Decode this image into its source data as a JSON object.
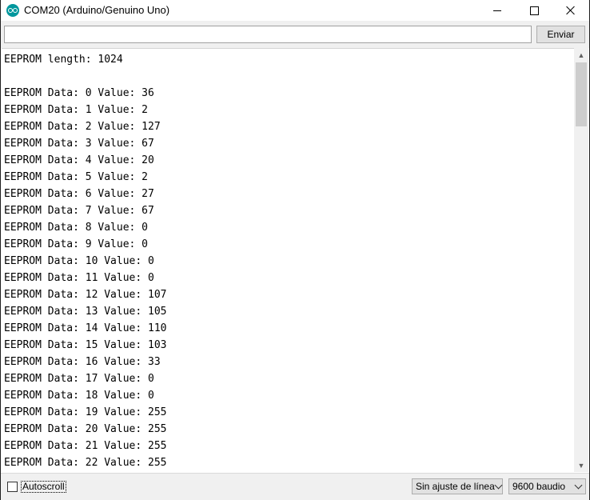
{
  "window": {
    "title": "COM20 (Arduino/Genuino Uno)"
  },
  "send": {
    "input_value": "",
    "button_label": "Enviar"
  },
  "output": {
    "lines": [
      "EEPROM length: 1024",
      "",
      "EEPROM Data: 0 Value: 36",
      "EEPROM Data: 1 Value: 2",
      "EEPROM Data: 2 Value: 127",
      "EEPROM Data: 3 Value: 67",
      "EEPROM Data: 4 Value: 20",
      "EEPROM Data: 5 Value: 2",
      "EEPROM Data: 6 Value: 27",
      "EEPROM Data: 7 Value: 67",
      "EEPROM Data: 8 Value: 0",
      "EEPROM Data: 9 Value: 0",
      "EEPROM Data: 10 Value: 0",
      "EEPROM Data: 11 Value: 0",
      "EEPROM Data: 12 Value: 107",
      "EEPROM Data: 13 Value: 105",
      "EEPROM Data: 14 Value: 110",
      "EEPROM Data: 15 Value: 103",
      "EEPROM Data: 16 Value: 33",
      "EEPROM Data: 17 Value: 0",
      "EEPROM Data: 18 Value: 0",
      "EEPROM Data: 19 Value: 255",
      "EEPROM Data: 20 Value: 255",
      "EEPROM Data: 21 Value: 255",
      "EEPROM Data: 22 Value: 255"
    ]
  },
  "footer": {
    "autoscroll_label": "Autoscroll",
    "autoscroll_checked": false,
    "line_ending": "Sin ajuste de línea",
    "baud_rate": "9600 baudio"
  },
  "icons": {
    "app": "arduino-logo-icon",
    "minimize": "minimize-icon",
    "maximize": "maximize-icon",
    "close": "close-icon",
    "scroll_up": "scroll-up-arrow-icon",
    "scroll_down": "scroll-down-arrow-icon",
    "dropdown": "chevron-down-icon"
  },
  "colors": {
    "arduino_teal": "#00979d"
  }
}
